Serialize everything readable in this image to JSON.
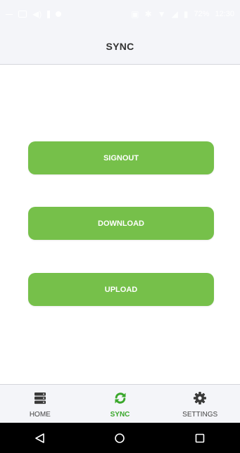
{
  "status_bar": {
    "battery": "72%",
    "time": "12:30"
  },
  "header": {
    "title": "SYNC"
  },
  "actions": {
    "signout_label": "SIGNOUT",
    "download_label": "DOWNLOAD",
    "upload_label": "UPLOAD",
    "button_color": "#76c04a"
  },
  "tabs": [
    {
      "label": "HOME",
      "icon": "server-icon",
      "active": false
    },
    {
      "label": "SYNC",
      "icon": "sync-icon",
      "active": true
    },
    {
      "label": "SETTINGS",
      "icon": "gear-icon",
      "active": false
    }
  ],
  "nav": {
    "back_icon": "back-triangle-icon",
    "home_icon": "home-circle-icon",
    "recents_icon": "recents-square-icon"
  },
  "colors": {
    "accent": "#3aa72b",
    "bars": "#f4f5f9"
  }
}
